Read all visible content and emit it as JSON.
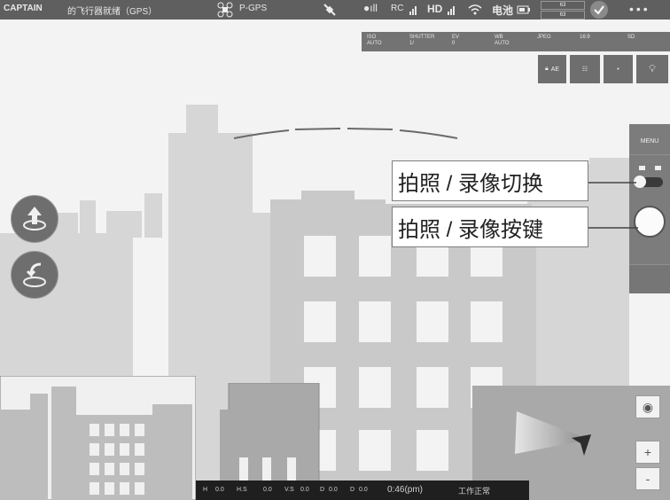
{
  "top_bar": {
    "brand": "CAPTAIN",
    "flight_status": "的飞行器就绪（GPS）",
    "gps_label": "P-GPS",
    "rc_label": "RC",
    "hd_label": "HD",
    "battery_label": "电池",
    "battery_top": "63",
    "battery_bottom": "63",
    "check_icon": "check-icon",
    "menu_icon": "more-icon"
  },
  "camera_params": [
    {
      "label": "ISO",
      "value": "AUTO"
    },
    {
      "label": "SHUTTER",
      "value": "1/"
    },
    {
      "label": "EV",
      "value": "0"
    },
    {
      "label": "WB",
      "value": "AUTO"
    },
    {
      "label": "",
      "value": "JPEG"
    },
    {
      "label": "",
      "value": "16:9"
    },
    {
      "label": "",
      "value": "SD"
    }
  ],
  "settings_buttons": [
    {
      "label": "AE",
      "icon": "lock-icon"
    },
    {
      "label": "",
      "icon": "camera-settings-icon"
    },
    {
      "label": "",
      "icon": "dot-icon"
    },
    {
      "label": "",
      "icon": "light-icon"
    }
  ],
  "camera_panel": {
    "camera_setting_label": "MENU",
    "mode_switch_icons": [
      "camera-icon",
      "video-icon"
    ]
  },
  "callouts": {
    "mode_switch": "拍照 / 录像切换",
    "shutter": "拍照 / 录像按键"
  },
  "left_buttons": {
    "takeoff_icon": "takeoff-icon",
    "return_home_icon": "return-home-icon"
  },
  "status_bar": {
    "items": [
      "H",
      "0.0",
      "H.S",
      "0.0",
      "V.S",
      "0.0",
      "D",
      "0.0",
      "D",
      "0.0"
    ],
    "battery_time": "0:46(pm)",
    "work_mode": "工作正常"
  },
  "map_controls": {
    "locate_icon": "locate-icon",
    "zoom_in": "+",
    "zoom_out": "-"
  },
  "colors": {
    "top_bar": "#5f5f5f",
    "panel": "#7c7c7c",
    "status_bar": "#1f1f1f",
    "background": "#f3f3f3"
  }
}
